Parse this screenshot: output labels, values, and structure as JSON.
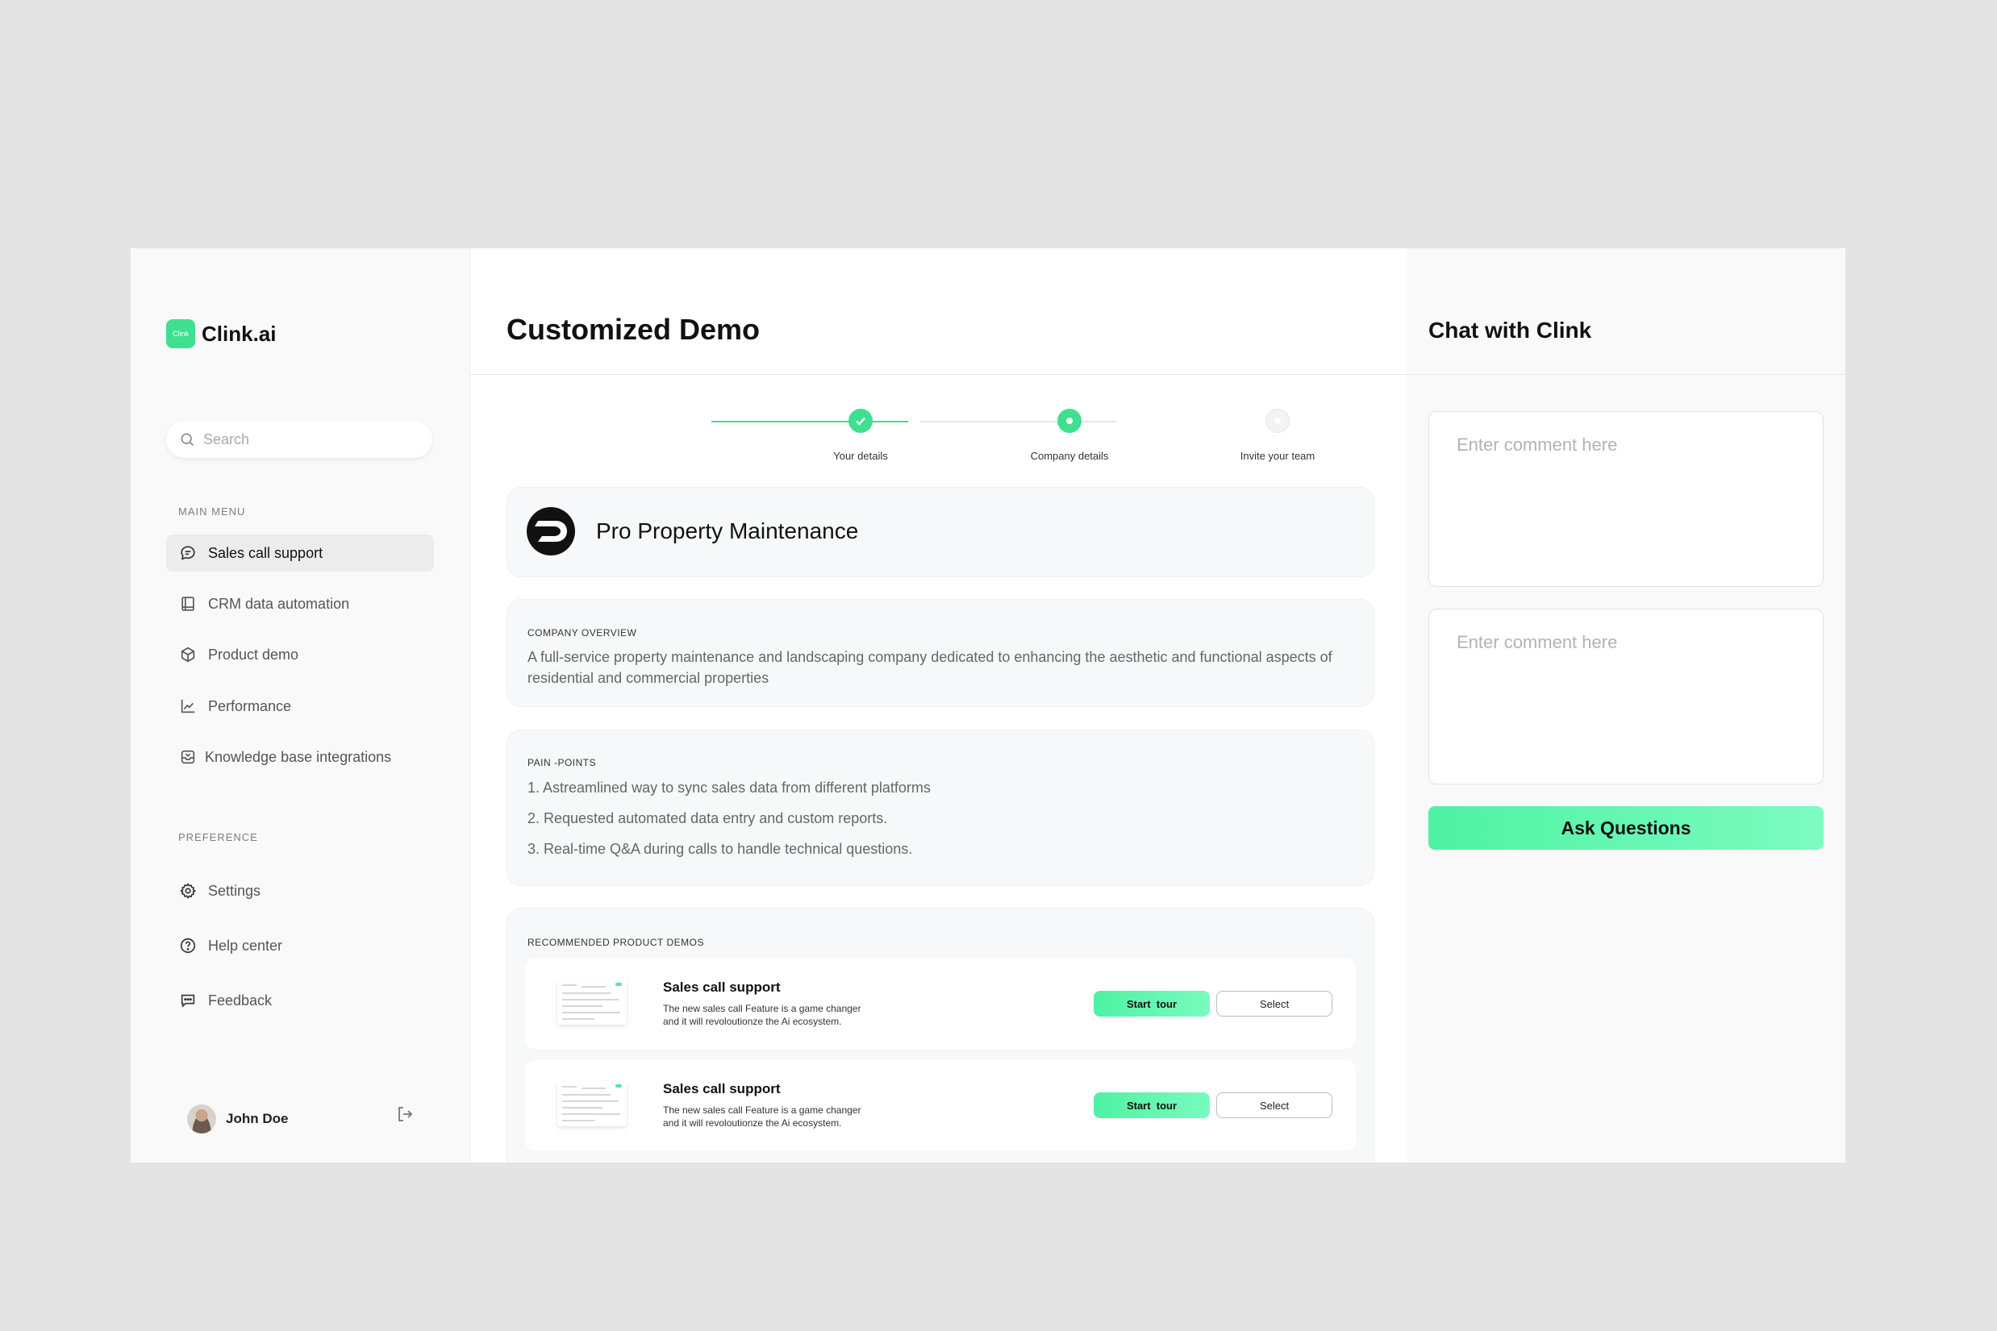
{
  "brand": {
    "logo_mark": "Clink",
    "name": "Clink.ai"
  },
  "search": {
    "placeholder": "Search"
  },
  "sidebar": {
    "main_menu_label": "MAIN MENU",
    "main_items": [
      {
        "label": "Sales call support",
        "icon": "chat-bubble-icon",
        "active": true
      },
      {
        "label": "CRM data automation",
        "icon": "book-icon",
        "active": false
      },
      {
        "label": "Product demo",
        "icon": "box-icon",
        "active": false
      },
      {
        "label": "Performance",
        "icon": "chart-line-icon",
        "active": false
      },
      {
        "label": "Knowledge base integrations",
        "icon": "inbox-icon",
        "active": false
      }
    ],
    "preference_label": "PREFERENCE",
    "pref_items": [
      {
        "label": "Settings",
        "icon": "gear-icon"
      },
      {
        "label": "Help center",
        "icon": "help-circle-icon"
      },
      {
        "label": "Feedback",
        "icon": "message-icon"
      }
    ]
  },
  "user": {
    "name": "John Doe"
  },
  "main": {
    "title": "Customized Demo",
    "steps": [
      {
        "label": "Your details",
        "state": "complete"
      },
      {
        "label": "Company details",
        "state": "current"
      },
      {
        "label": "Invite your team",
        "state": "upcoming"
      }
    ],
    "company": {
      "name": "Pro Property Maintenance"
    },
    "overview": {
      "label": "COMPANY OVERVIEW",
      "text": "A full-service property maintenance and landscaping company dedicated to enhancing the aesthetic and functional aspects of residential and commercial properties"
    },
    "pain_points": {
      "label": "PAIN -POINTS",
      "items": [
        "1. Astreamlined way to sync sales data from different platforms",
        "2. Requested automated data entry and custom reports.",
        "3. Real-time Q&A during calls to handle technical questions."
      ]
    },
    "recommended": {
      "label": "RECOMMENDED PRODUCT DEMOS",
      "items": [
        {
          "title": "Sales call support",
          "desc_line1": "The new sales call Feature is a game changer",
          "desc_line2": "and it will revoloutionze the Ai ecosystem.",
          "start_label": "Start  tour",
          "select_label": "Select"
        },
        {
          "title": "Sales call support",
          "desc_line1": "The new sales call Feature is a game changer",
          "desc_line2": "and it will revoloutionze the Ai ecosystem.",
          "start_label": "Start  tour",
          "select_label": "Select"
        }
      ]
    }
  },
  "chat": {
    "title": "Chat with Clink",
    "comment_placeholder_1": "Enter comment here",
    "comment_placeholder_2": "Enter comment here",
    "ask_label": "Ask Questions"
  },
  "colors": {
    "accent": "#3ee08f",
    "accent_light": "#79fbbe",
    "background": "#e4e4e4"
  }
}
